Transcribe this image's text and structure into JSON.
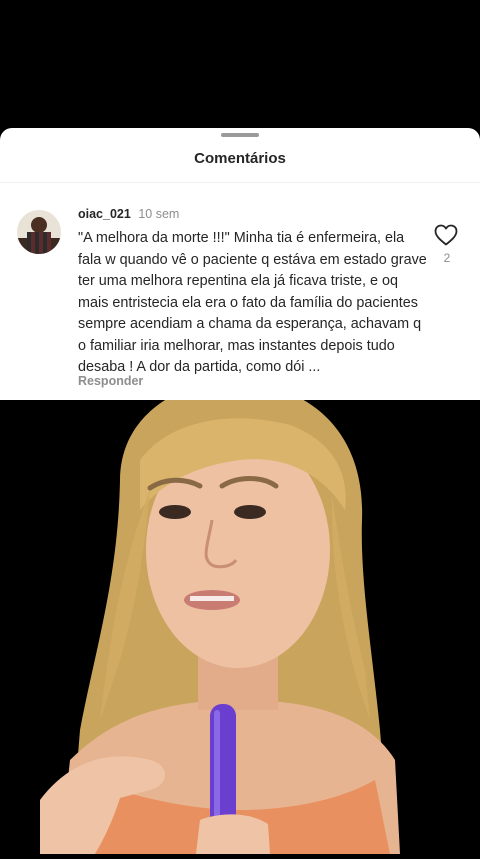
{
  "sheet": {
    "title": "Comentários"
  },
  "comment": {
    "username": "oiac_021",
    "time": "10 sem",
    "text": "\"A melhora da morte !!!\" Minha tia é enfermeira, ela fala w quando vê o paciente q estáva em estado grave ter uma melhora repentina ela já ficava triste, e oq mais entristecia ela era o fato da família do pacientes sempre acendiam a chama da esperança, achavam q o familiar iria melhorar, mas instantes depois tudo desaba ! A dor da partida, como dói ...",
    "reply_label": "Responder",
    "like_count": "2"
  },
  "icons": {
    "like": "heart-outline-icon"
  },
  "colors": {
    "sheet_bg": "#ffffff",
    "text_primary": "#262626",
    "text_secondary": "#8e8e8e"
  }
}
